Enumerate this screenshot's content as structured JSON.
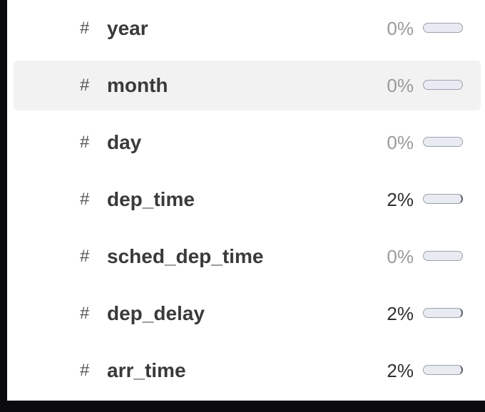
{
  "columns": [
    {
      "type_symbol": "#",
      "name": "year",
      "missing_label": "0%",
      "missing_fraction": 0.0
    },
    {
      "type_symbol": "#",
      "name": "month",
      "missing_label": "0%",
      "missing_fraction": 0.0
    },
    {
      "type_symbol": "#",
      "name": "day",
      "missing_label": "0%",
      "missing_fraction": 0.0
    },
    {
      "type_symbol": "#",
      "name": "dep_time",
      "missing_label": "2%",
      "missing_fraction": 0.02
    },
    {
      "type_symbol": "#",
      "name": "sched_dep_time",
      "missing_label": "0%",
      "missing_fraction": 0.0
    },
    {
      "type_symbol": "#",
      "name": "dep_delay",
      "missing_label": "2%",
      "missing_fraction": 0.02
    },
    {
      "type_symbol": "#",
      "name": "arr_time",
      "missing_label": "2%",
      "missing_fraction": 0.02
    }
  ],
  "colors": {
    "hover_row": "#f2f2f2",
    "zero_text": "#9a9a9a",
    "nonzero_text": "#2f2f2f",
    "bar_track": "#e8ebf2"
  }
}
